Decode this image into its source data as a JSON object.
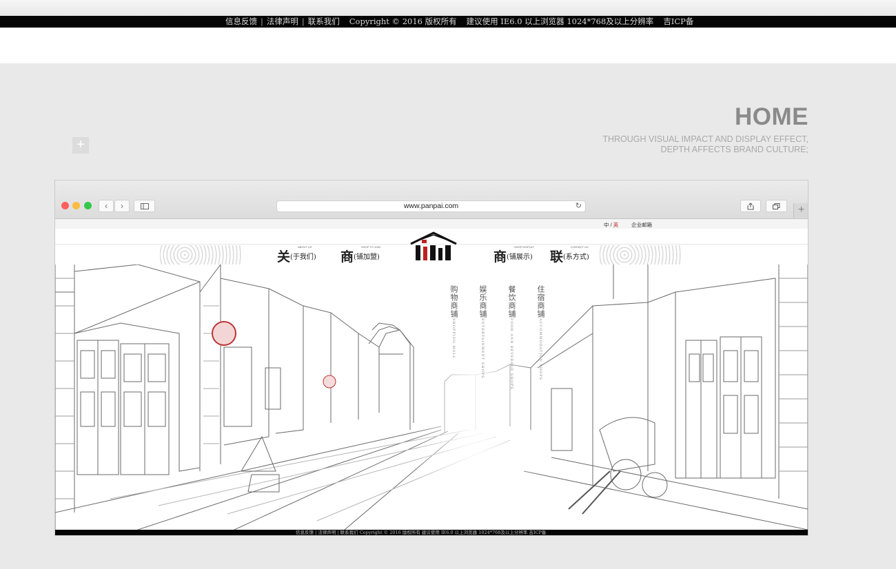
{
  "outer_footer": {
    "links": [
      "信息反馈",
      "法律声明",
      "联系我们"
    ],
    "copyright": "Copyright © 2016 版权所有",
    "browser_note": "建议使用 IE6.0 以上浏览器 1024*768及以上分辨率",
    "icp": "吉ICP备"
  },
  "hero": {
    "title": "HOME",
    "subtitle_line1": "THROUGH VISUAL IMPACT AND DISPLAY EFFECT,",
    "subtitle_line2": "DEPTH AFFECTS BRAND CULTURE;",
    "plus": "+"
  },
  "browser": {
    "url": "www.panpai.com",
    "tab_plus": "+"
  },
  "site": {
    "lang_cn": "中",
    "lang_slash": "/",
    "lang_en": "英",
    "mail": "企业邮箱",
    "nav": [
      {
        "big": "关",
        "small": "(于我们)",
        "tiny": "ABOUT US"
      },
      {
        "big": "商",
        "small": "(铺加盟)",
        "tiny": "SHOP TO JOIN"
      },
      {
        "big": "商",
        "small": "(铺展示)",
        "tiny": "SHOP DISPLAY"
      },
      {
        "big": "联",
        "small": "(系方式)",
        "tiny": "CONTACT US"
      }
    ],
    "categories": [
      {
        "cn": "购物商铺",
        "en": "SHOPPING MALL"
      },
      {
        "cn": "娱乐商铺",
        "en": "ENTERTAINMENT SHOPS"
      },
      {
        "cn": "餐饮商铺",
        "en": "FOOD AND BEVERAGE SHOPS"
      },
      {
        "cn": "住宿商铺",
        "en": "ACCOMMODATION SHOPS"
      }
    ],
    "inner_footer": "信息反馈 | 法律声明 | 联系我们    Copyright © 2016 版权所有    建议使用 IE6.0 以上浏览器 1024*768及以上分辨率    吉ICP备"
  },
  "colors": {
    "background": "#e9e9e9",
    "footer_bar": "#050505",
    "home_title": "#8a8a8a",
    "traffic_red": "#fc605c",
    "traffic_yellow": "#fdbc40",
    "traffic_green": "#34c84a",
    "accent_red": "#c03030"
  },
  "icons": [
    "chevron-left-icon",
    "chevron-right-icon",
    "sidebar-icon",
    "reload-icon",
    "share-icon",
    "tabs-icon",
    "plus-icon"
  ]
}
